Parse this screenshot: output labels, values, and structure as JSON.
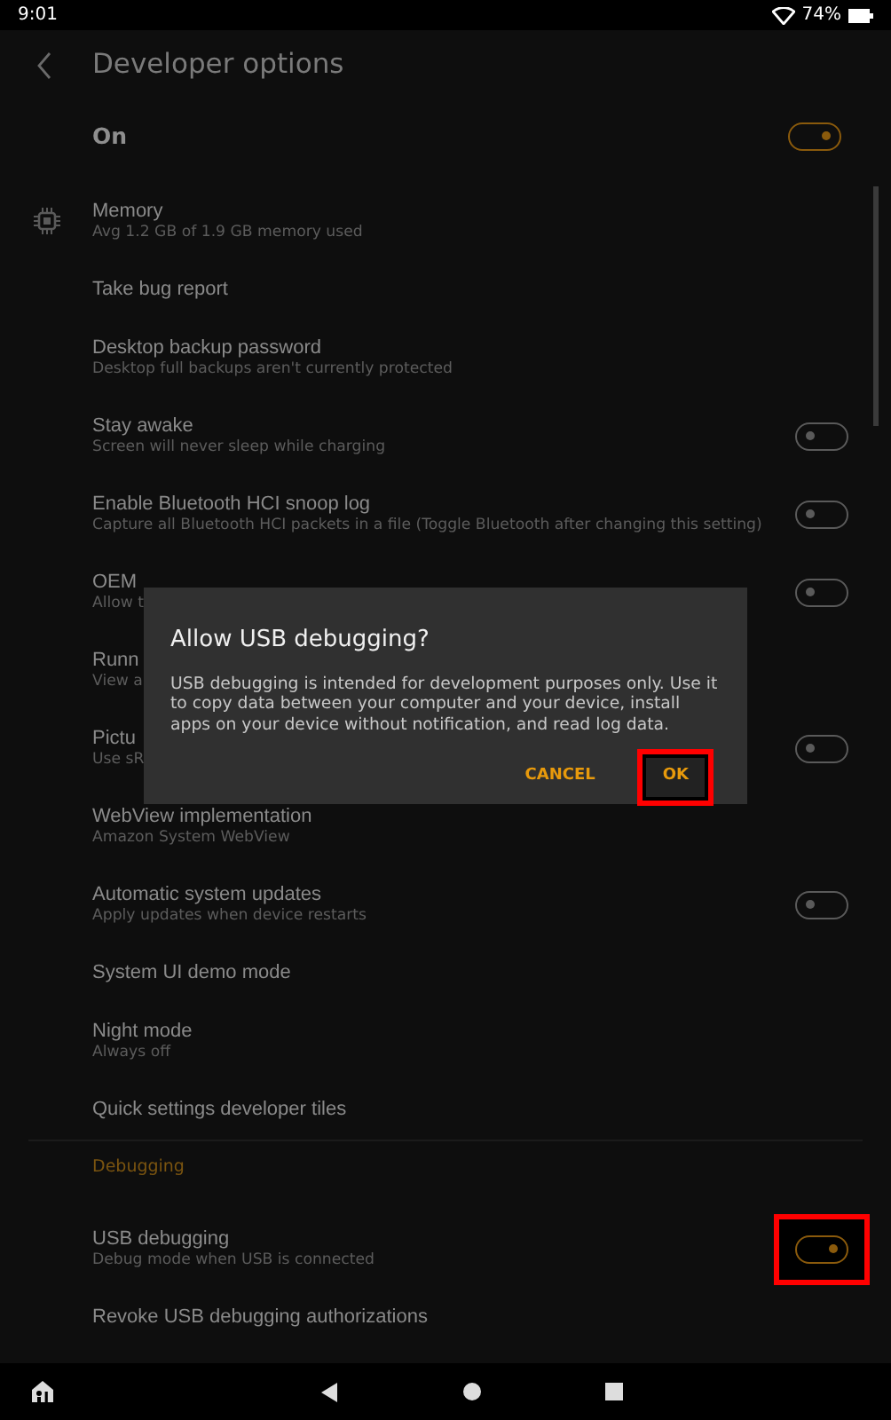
{
  "status_bar": {
    "time": "9:01",
    "battery": "74%"
  },
  "header": {
    "title": "Developer options"
  },
  "master": {
    "label": "On",
    "toggle": {
      "on": true,
      "highlighted": false
    }
  },
  "items": [
    {
      "kind": "setting_with_icon",
      "title": "Memory",
      "subtitle": "Avg 1.2 GB of 1.9 GB memory used"
    },
    {
      "kind": "setting",
      "title": "Take bug report"
    },
    {
      "kind": "setting",
      "title": "Desktop backup password",
      "subtitle": "Desktop full backups aren't currently protected"
    },
    {
      "kind": "setting",
      "title": "Stay awake",
      "subtitle": "Screen will never sleep while charging",
      "toggle": {
        "on": false,
        "highlighted": false
      }
    },
    {
      "kind": "setting",
      "title": "Enable Bluetooth HCI snoop log",
      "subtitle": "Capture all Bluetooth HCI packets in a file (Toggle Bluetooth after changing this setting)",
      "toggle": {
        "on": false,
        "highlighted": false
      }
    },
    {
      "kind": "setting",
      "title": "OEM",
      "subtitle": "Allow t",
      "toggle": {
        "on": false,
        "highlighted": false
      }
    },
    {
      "kind": "setting",
      "title": "Runn",
      "subtitle": "View a"
    },
    {
      "kind": "setting",
      "title": "Pictu",
      "subtitle": "Use sR",
      "toggle": {
        "on": false,
        "highlighted": false
      }
    },
    {
      "kind": "setting",
      "title": "WebView implementation",
      "subtitle": "Amazon System WebView"
    },
    {
      "kind": "setting",
      "title": "Automatic system updates",
      "subtitle": "Apply updates when device restarts",
      "toggle": {
        "on": false,
        "highlighted": false
      }
    },
    {
      "kind": "setting",
      "title": "System UI demo mode"
    },
    {
      "kind": "setting",
      "title": "Night mode",
      "subtitle": "Always off"
    },
    {
      "kind": "setting",
      "title": "Quick settings developer tiles"
    },
    {
      "kind": "section",
      "title": "Debugging"
    },
    {
      "kind": "setting",
      "title": "USB debugging",
      "subtitle": "Debug mode when USB is connected",
      "toggle": {
        "on": true,
        "highlighted": true
      }
    },
    {
      "kind": "setting",
      "title": "Revoke USB debugging authorizations"
    }
  ],
  "dialog": {
    "title": "Allow USB debugging?",
    "message": "USB debugging is intended for development purposes only. Use it to copy data between your computer and your device, install apps on your device without notification, and read log data.",
    "buttons": [
      {
        "label": "CANCEL",
        "highlighted": false
      },
      {
        "label": "OK",
        "highlighted": true
      }
    ]
  }
}
